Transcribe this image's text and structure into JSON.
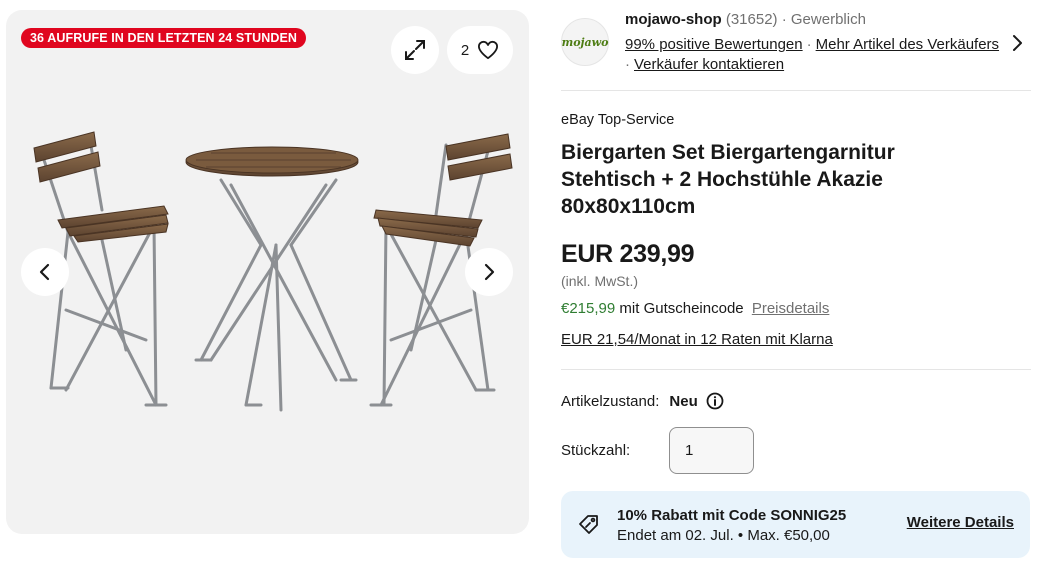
{
  "gallery": {
    "views_badge": "36 AUFRUFE IN DEN LETZTEN 24 STUNDEN",
    "watch_count": "2",
    "icons": {
      "expand": "expand-icon",
      "heart": "heart-icon",
      "prev": "chevron-left-icon",
      "next": "chevron-right-icon"
    }
  },
  "seller": {
    "logo_text": "mojawo",
    "name": "mojawo-shop",
    "rating_count": "(31652)",
    "type": "Gewerblich",
    "feedback": "99% positive Bewertungen",
    "more_items": "Mehr Artikel des Verkäufers",
    "contact": "Verkäufer kontaktieren"
  },
  "listing": {
    "top_service": "eBay Top-Service",
    "title": "Biergarten Set Biergartengarnitur Stehtisch + 2 Hochstühle Akazie 80x80x110cm",
    "price": "EUR 239,99",
    "vat": "(inkl. MwSt.)",
    "coupon_price": "€215,99",
    "coupon_text": "mit Gutscheincode",
    "price_details": "Preisdetails",
    "installment": "EUR 21,54/Monat in 12 Raten mit Klarna",
    "condition_label": "Artikelzustand:",
    "condition_value": "Neu",
    "quantity_label": "Stückzahl:",
    "quantity_value": "1"
  },
  "promo": {
    "title": "10% Rabatt mit Code SONNIG25",
    "subtitle": "Endet am 02. Jul. • Max. €50,00",
    "link": "Weitere Details"
  },
  "colors": {
    "badge": "#e0061f",
    "promo_bg": "#e8f3fb",
    "coupon_green": "#2f7d32"
  }
}
